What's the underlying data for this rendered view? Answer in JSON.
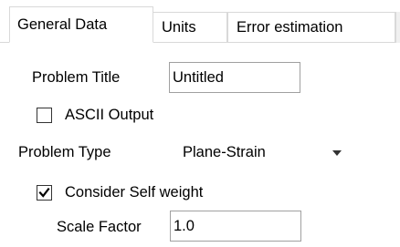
{
  "tabs": [
    {
      "label": "General Data",
      "active": true
    },
    {
      "label": "Units",
      "active": false
    },
    {
      "label": "Error estimation",
      "active": false
    }
  ],
  "general": {
    "problem_title_label": "Problem Title",
    "problem_title_value": "Untitled",
    "ascii_output_label": "ASCII Output",
    "ascii_output_checked": false,
    "problem_type_label": "Problem Type",
    "problem_type_value": "Plane-Strain",
    "self_weight_label": "Consider Self weight",
    "self_weight_checked": true,
    "scale_factor_label": "Scale Factor",
    "scale_factor_value": "1.0"
  },
  "icons": {
    "check": "checkmark-icon",
    "dropdown": "chevron-down-icon"
  },
  "colors": {
    "border": "#d9d9d9",
    "input_border": "#a0a0a0",
    "text": "#000000",
    "background": "#ffffff"
  }
}
